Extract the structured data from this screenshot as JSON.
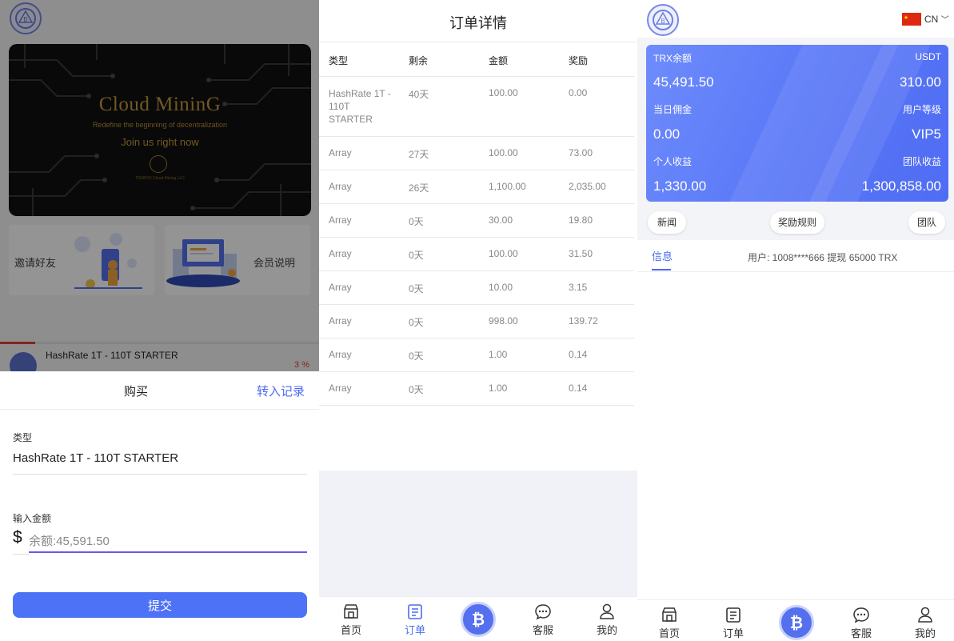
{
  "panel_buy": {
    "banner": {
      "title": "Cloud MininG",
      "subtitle": "Redefine the beginning of decentralization",
      "cta": "Join us right now",
      "small": "TRXBOX Cloud Mining LLC"
    },
    "cards": [
      {
        "label": "邀请好友"
      },
      {
        "label": "会员说明"
      }
    ],
    "product": {
      "name": "HashRate 1T - 110T STARTER",
      "percent": "3 %",
      "progress": 0.11
    },
    "sheet": {
      "title": "购买",
      "link": "转入记录",
      "type_label": "类型",
      "type_value": "HashRate 1T - 110T STARTER",
      "amount_label": "输入金额",
      "currency_symbol": "$",
      "amount_placeholder": "余额:45,591.50",
      "submit_label": "提交"
    }
  },
  "panel_orders": {
    "title": "订单详情",
    "columns": [
      "类型",
      "剩余",
      "金额",
      "奖励"
    ],
    "rows": [
      [
        "HashRate 1T - 110T STARTER",
        "40天",
        "100.00",
        "0.00"
      ],
      [
        "Array",
        "27天",
        "100.00",
        "73.00"
      ],
      [
        "Array",
        "26天",
        "1,100.00",
        "2,035.00"
      ],
      [
        "Array",
        "0天",
        "30.00",
        "19.80"
      ],
      [
        "Array",
        "0天",
        "100.00",
        "31.50"
      ],
      [
        "Array",
        "0天",
        "10.00",
        "3.15"
      ],
      [
        "Array",
        "0天",
        "998.00",
        "139.72"
      ],
      [
        "Array",
        "0天",
        "1.00",
        "0.14"
      ],
      [
        "Array",
        "0天",
        "1.00",
        "0.14"
      ]
    ],
    "tabbar": {
      "home": "首页",
      "orders": "订单",
      "service": "客服",
      "mine": "我的",
      "active": "orders"
    }
  },
  "panel_home": {
    "language": "CN",
    "balance_card": {
      "trx_label": "TRX余额",
      "trx_value": "45,491.50",
      "usdt_label": "USDT",
      "usdt_value": "310.00",
      "commission_label": "当日佣金",
      "commission_value": "0.00",
      "level_label": "用户等级",
      "level_value": "VIP5",
      "personal_label": "个人收益",
      "personal_value": "1,330.00",
      "team_label": "团队收益",
      "team_value": "1,300,858.00"
    },
    "pills": {
      "news": "新闻",
      "rules": "奖励规则",
      "team": "团队"
    },
    "notice": {
      "tab": "信息",
      "text": "用户: 1008****666 提现 65000 TRX"
    },
    "tabbar": {
      "home": "首页",
      "orders": "订单",
      "service": "客服",
      "mine": "我的"
    }
  },
  "colors": {
    "accent": "#4a6bf0",
    "card": "#5a78f7",
    "danger": "#e0403a",
    "submit": "#4d72f5"
  }
}
